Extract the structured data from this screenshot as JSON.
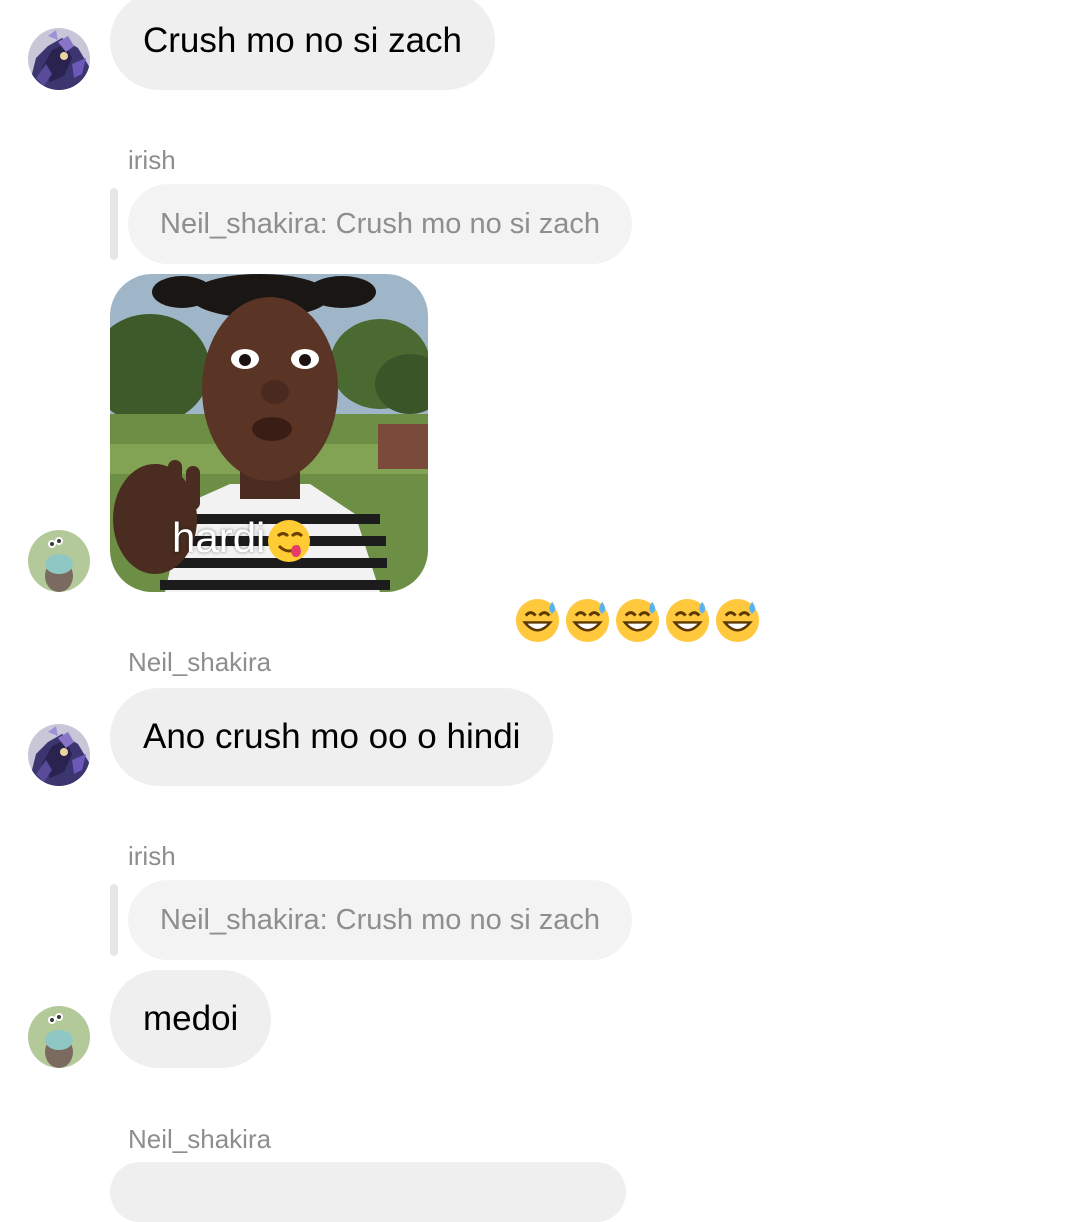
{
  "messages": [
    {
      "kind": "text",
      "text": "Crush mo no si zach"
    },
    {
      "kind": "sender",
      "name": "irish"
    },
    {
      "kind": "reply",
      "text": "Neil_shakira: Crush mo no si zach"
    },
    {
      "kind": "sticker",
      "caption": "hardi"
    },
    {
      "kind": "reactions",
      "emoji": "grinning-sweat-face",
      "count": 5
    },
    {
      "kind": "sender",
      "name": "Neil_shakira"
    },
    {
      "kind": "text",
      "text": "Ano crush mo oo o hindi"
    },
    {
      "kind": "sender",
      "name": "irish"
    },
    {
      "kind": "reply",
      "text": "Neil_shakira: Crush mo no si zach"
    },
    {
      "kind": "text",
      "text": "medoi"
    },
    {
      "kind": "sender",
      "name": "Neil_shakira"
    }
  ],
  "colors": {
    "bubble": "#efefef",
    "reply_bubble": "#f3f3f3",
    "meta_text": "#8e8e8e"
  },
  "icons": {
    "avatar_a": "armored-hero-avatar-icon",
    "avatar_b": "green-cartoon-avatar-icon",
    "reaction": "grinning-sweat-face-icon"
  }
}
